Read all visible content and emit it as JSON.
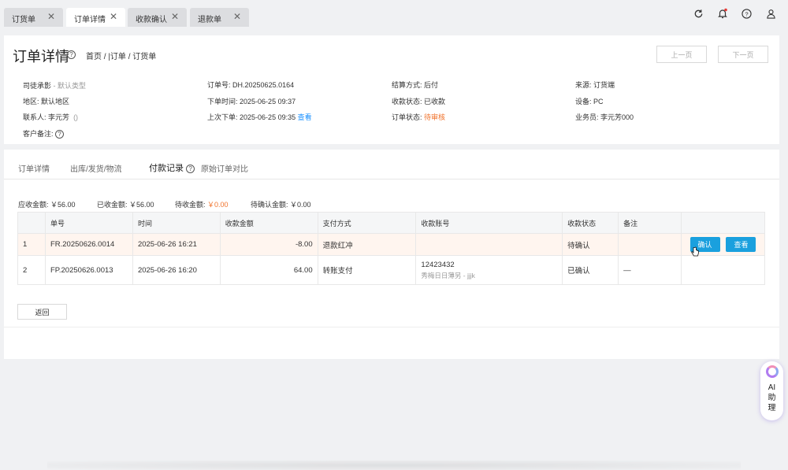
{
  "tabs": [
    {
      "label": "订货单",
      "active": false
    },
    {
      "label": "订单详情",
      "active": true
    },
    {
      "label": "收款确认",
      "active": false
    },
    {
      "label": "退款单",
      "active": false
    }
  ],
  "header": {
    "title": "订单详情",
    "breadcrumb": "首页 / |订单 / 订货单",
    "prev_label": "上一页",
    "next_label": "下一页"
  },
  "info": {
    "customer_name": "司徒承影",
    "customer_type": "- 默认类型",
    "region_label": "地区:",
    "region_value": "默认地区",
    "contact_label": "联系人:",
    "contact_value": "李元芳",
    "contact_phone": "()",
    "remark_label": "客户备注:",
    "order_no_label": "订单号:",
    "order_no_value": "DH.20250625.0164",
    "order_time_label": "下单时间:",
    "order_time_value": "2025-06-25 09:37",
    "last_order_label": "上次下单:",
    "last_order_value": "2025-06-25 09:35",
    "last_order_link": "查看",
    "settle_label": "结算方式:",
    "settle_value": "后付",
    "pay_status_label": "收款状态:",
    "pay_status_value": "已收款",
    "order_status_label": "订单状态:",
    "order_status_value": "待审核",
    "source_label": "来源:",
    "source_value": "订货端",
    "device_label": "设备:",
    "device_value": "PC",
    "sales_label": "业务员:",
    "sales_value": "李元芳000"
  },
  "subtabs": [
    "订单详情",
    "出库/发货/物流",
    "付款记录",
    "原始订单对比"
  ],
  "summary": {
    "receivable": "应收金额: ￥56.00",
    "received": "已收金额: ￥56.00",
    "pending_label": "待收金额:",
    "pending_value": "￥0.00",
    "to_confirm": "待确认金额: ￥0.00"
  },
  "table": {
    "headers": [
      "",
      "单号",
      "时间",
      "收款金额",
      "支付方式",
      "收款账号",
      "收款状态",
      "备注",
      ""
    ],
    "rows": [
      {
        "idx": "1",
        "no": "FR.20250626.0014",
        "time": "2025-06-26 16:21",
        "amount": "-8.00",
        "method": "退款红冲",
        "account": "",
        "account_sub": "",
        "status": "待确认",
        "remark": "",
        "btn_confirm": "确认",
        "btn_view": "查看"
      },
      {
        "idx": "2",
        "no": "FP.20250626.0013",
        "time": "2025-06-26 16:20",
        "amount": "64.00",
        "method": "转账支付",
        "account": "12423432",
        "account_sub": "秀梅日日薄另 - jjjk",
        "status": "已确认",
        "remark": "—"
      }
    ]
  },
  "return_label": "返回",
  "ai": {
    "label": "AI助理"
  },
  "colors": {
    "accent": "#1aa0de",
    "orange": "#f0722b",
    "negative": "#c0392b"
  }
}
